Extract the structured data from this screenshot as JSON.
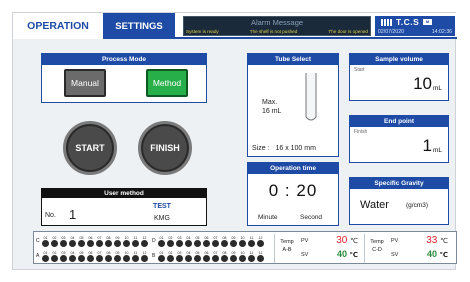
{
  "tabs": {
    "operation": "OPERATION",
    "settings": "SETTINGS"
  },
  "alarm": {
    "title": "Alarm Message",
    "system": "System is ready",
    "shelf": "The shelf is not pushed",
    "door": "The door is opened"
  },
  "brand": {
    "logo": "T.C.S",
    "tag": "M",
    "date": "02/07/2020",
    "time": "14:02:36"
  },
  "process_mode": {
    "title": "Process Mode",
    "manual": "Manual",
    "method": "Method"
  },
  "controls": {
    "start": "START",
    "finish": "FINISH"
  },
  "user_method": {
    "title": "User method",
    "no_label": "No.",
    "no_value": "1",
    "name": "TEST",
    "user": "KMG"
  },
  "tube": {
    "title": "Tube Select",
    "max_label": "Max.",
    "max_value": "16 mL",
    "size_label": "Size :",
    "size_value": "16 x 100 mm"
  },
  "operation_time": {
    "title": "Operation time",
    "minute": "0",
    "second": "20",
    "sep": ":",
    "minute_label": "Minute",
    "second_label": "Second"
  },
  "sample_volume": {
    "title": "Sample volume",
    "label": "Start",
    "value": "10",
    "unit": "mL"
  },
  "end_point": {
    "title": "End point",
    "label": "Finish",
    "value": "1",
    "unit": "mL"
  },
  "gravity": {
    "title": "Specific Gravity",
    "value": "Water",
    "unit": "(g/cm3)"
  },
  "racks": {
    "rows_top": [
      "C",
      "D"
    ],
    "rows_bottom": [
      "A",
      "B"
    ],
    "slots": [
      "01",
      "02",
      "03",
      "04",
      "05",
      "06",
      "07",
      "08",
      "09",
      "10",
      "11",
      "12"
    ]
  },
  "temp_ab": {
    "name_1": "Temp",
    "name_2": "A-B",
    "pv_label": "PV",
    "pv": "30",
    "sv_label": "SV",
    "sv": "40",
    "unit": "℃"
  },
  "temp_cd": {
    "name_1": "Temp",
    "name_2": "C-D",
    "pv_label": "PV",
    "pv": "33",
    "sv_label": "SV",
    "sv": "40",
    "unit": "℃"
  },
  "colors": {
    "primary": "#1e4ba6",
    "method_green": "#27b04a",
    "pv_red": "#e0262a",
    "sv_green": "#2a8a3a"
  }
}
